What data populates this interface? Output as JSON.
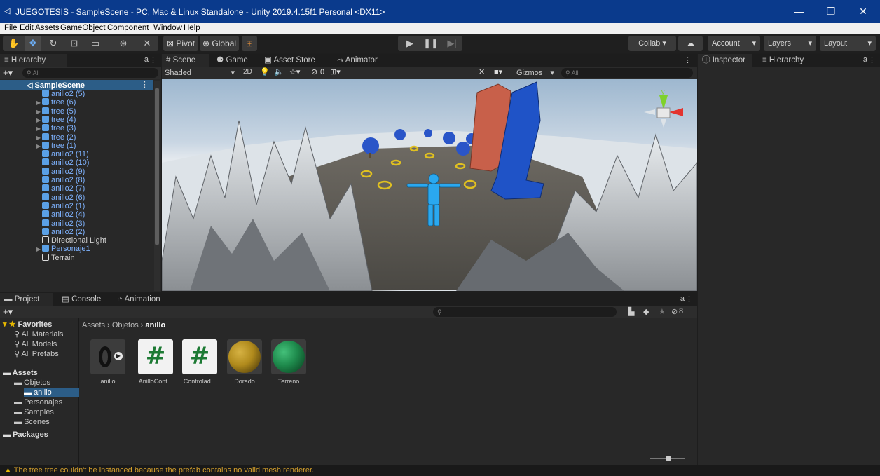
{
  "window": {
    "title": "JUEGOTESIS - SampleScene - PC, Mac & Linux Standalone - Unity 2019.4.15f1 Personal <DX11>",
    "minimize": "—",
    "maximize": "❐",
    "close": "✕"
  },
  "menu": [
    "File",
    "Edit",
    "Assets",
    "GameObject",
    "Component",
    "Window",
    "Help"
  ],
  "toolbar": {
    "pivot": "Pivot",
    "global": "Global",
    "collab": "Collab ▾",
    "account": "Account",
    "layers": "Layers",
    "layout": "Layout"
  },
  "hierarchy": {
    "tab": "Hierarchy",
    "search_placeholder": "All",
    "scene": "SampleScene",
    "items": [
      {
        "label": "anillo2 (5)",
        "arrow": ""
      },
      {
        "label": "tree (6)",
        "arrow": "▶"
      },
      {
        "label": "tree (5)",
        "arrow": "▶"
      },
      {
        "label": "tree (4)",
        "arrow": "▶"
      },
      {
        "label": "tree (3)",
        "arrow": "▶"
      },
      {
        "label": "tree (2)",
        "arrow": "▶"
      },
      {
        "label": "tree (1)",
        "arrow": "▶"
      },
      {
        "label": "anillo2 (11)",
        "arrow": ""
      },
      {
        "label": "anillo2 (10)",
        "arrow": ""
      },
      {
        "label": "anillo2 (9)",
        "arrow": ""
      },
      {
        "label": "anillo2 (8)",
        "arrow": ""
      },
      {
        "label": "anillo2 (7)",
        "arrow": ""
      },
      {
        "label": "anillo2 (6)",
        "arrow": ""
      },
      {
        "label": "anillo2 (1)",
        "arrow": ""
      },
      {
        "label": "anillo2 (4)",
        "arrow": ""
      },
      {
        "label": "anillo2 (3)",
        "arrow": ""
      },
      {
        "label": "anillo2 (2)",
        "arrow": ""
      },
      {
        "label": "Directional Light",
        "arrow": ""
      },
      {
        "label": "Personaje1",
        "arrow": "▶"
      },
      {
        "label": "Terrain",
        "arrow": ""
      }
    ]
  },
  "scene_tabs": {
    "scene": "Scene",
    "game": "Game",
    "asset_store": "Asset Store",
    "animator": "Animator",
    "shading": "Shaded",
    "mode_2d": "2D",
    "hidden_count": "0",
    "gizmos": "Gizmos",
    "search_placeholder": "All"
  },
  "inspector": {
    "tab_inspector": "Inspector",
    "tab_hierarchy": "Hierarchy"
  },
  "project": {
    "tab_project": "Project",
    "tab_console": "Console",
    "tab_animation": "Animation",
    "hidden_count": "8",
    "breadcrumb": [
      "Assets",
      "Objetos",
      "anillo"
    ],
    "favorites": {
      "label": "Favorites",
      "items": [
        "All Materials",
        "All Models",
        "All Prefabs"
      ]
    },
    "tree": [
      {
        "label": "Assets",
        "level": "root",
        "bold": true
      },
      {
        "label": "Objetos",
        "level": "child"
      },
      {
        "label": "anillo",
        "level": "grandchild",
        "selected": true
      },
      {
        "label": "Personajes",
        "level": "child"
      },
      {
        "label": "Samples",
        "level": "child"
      },
      {
        "label": "Scenes",
        "level": "child"
      },
      {
        "label": "Packages",
        "level": "root",
        "bold": true
      }
    ],
    "assets": [
      {
        "name": "anillo",
        "kind": "model"
      },
      {
        "name": "AnilloCont...",
        "kind": "script"
      },
      {
        "name": "Controlad...",
        "kind": "script"
      },
      {
        "name": "Dorado",
        "kind": "material",
        "color": "#b08a1c"
      },
      {
        "name": "Terreno",
        "kind": "material",
        "color": "#1e8a4c"
      }
    ]
  },
  "status": {
    "message": "The tree tree couldn't be instanced because the prefab contains no valid mesh renderer."
  },
  "colors": {
    "titlebar": "#0a3a8c",
    "hierarchy_text": "#7fb3ff",
    "warning": "#d6a12c",
    "character": "#2aa8f0",
    "tower_blue": "#1f53c7",
    "tower_red": "#c8604a",
    "ring": "#e0c020"
  }
}
